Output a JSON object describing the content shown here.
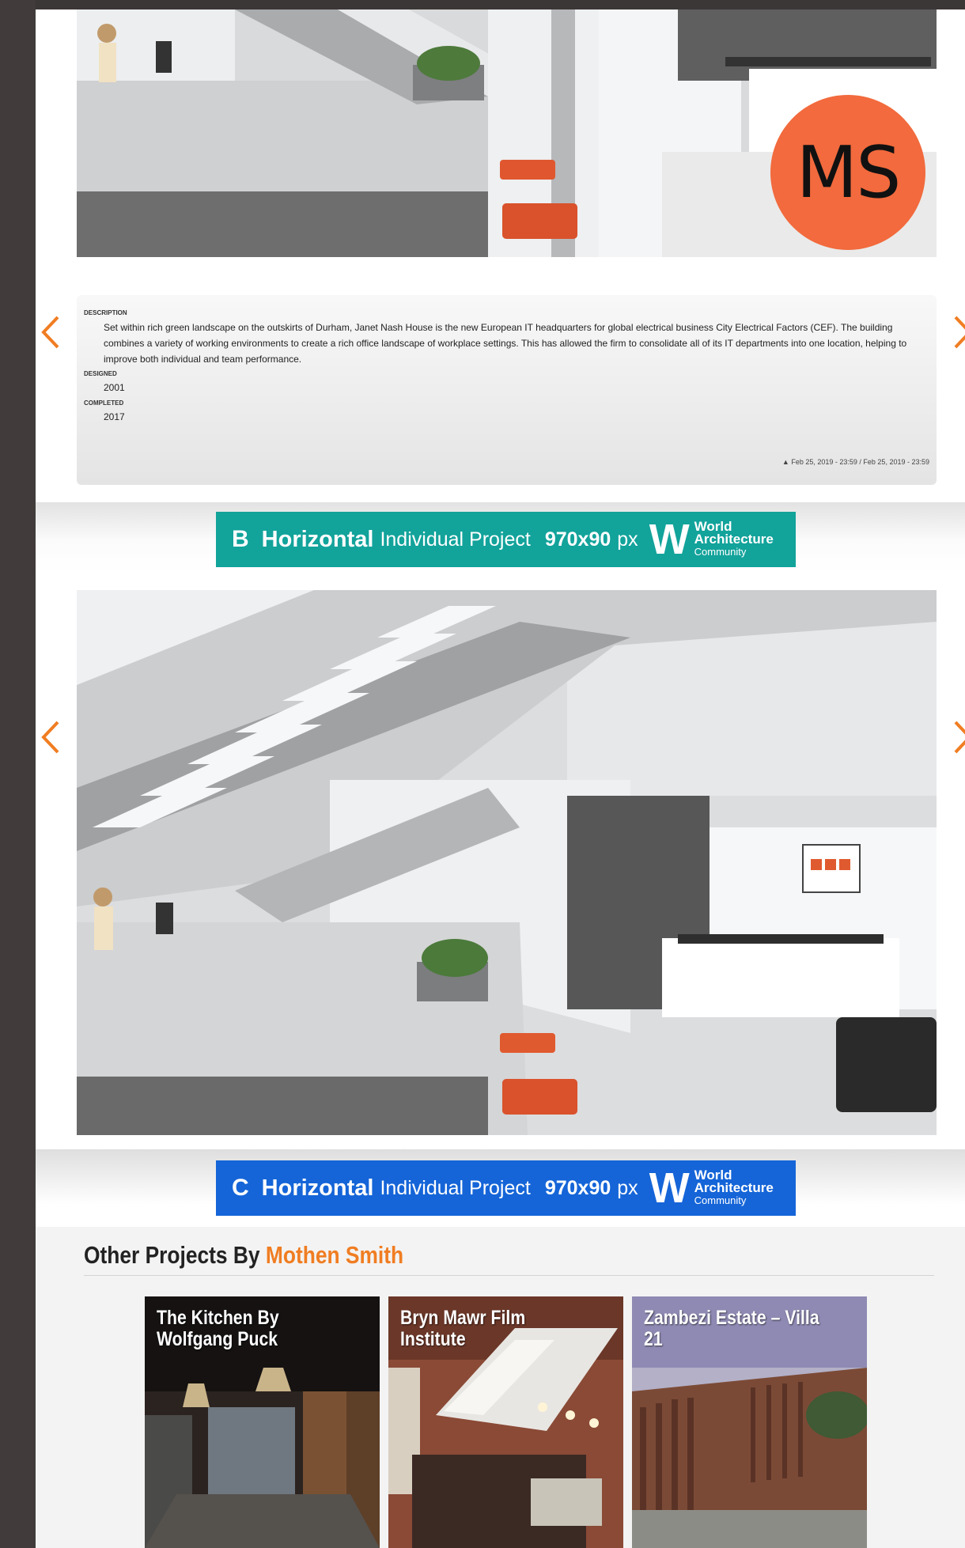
{
  "avatar": {
    "initials": "MS",
    "color": "#f26a3d"
  },
  "nav": {
    "prev_icon": "chevron-left-icon",
    "next_icon": "chevron-right-icon",
    "accent": "#f07d22"
  },
  "description": {
    "label": "DESCRIPTION",
    "text": "Set within rich green landscape on the outskirts of Durham, Janet Nash House is the new European IT headquarters for global electrical business City Electrical Factors (CEF). The building combines a variety of working environments to create a rich office landscape of workplace settings. This has allowed the firm to consolidate all of its IT departments into one location, helping to improve both individual and team performance.",
    "designed_label": "DESIGNED",
    "designed": "2001",
    "completed_label": "COMPLETED",
    "completed": "2017",
    "timestamp": "Feb 25, 2019 - 23:59 / Feb 25, 2019 - 23:59"
  },
  "ads": [
    {
      "letter": "B",
      "horizontal": "Horizontal",
      "project": "Individual Project",
      "size": "970x90",
      "unit": "px",
      "logo_w": "W",
      "logo_l1": "World",
      "logo_l2": "Architecture",
      "logo_l3": "Community",
      "color": "#12a39b"
    },
    {
      "letter": "C",
      "horizontal": "Horizontal",
      "project": "Individual Project",
      "size": "970x90",
      "unit": "px",
      "logo_w": "W",
      "logo_l1": "World",
      "logo_l2": "Architecture",
      "logo_l3": "Community",
      "color": "#1565d8"
    }
  ],
  "other": {
    "title_prefix": "Other Projects By",
    "author": "Mothen Smith",
    "cards": [
      {
        "title": "The Kitchen By Wolfgang Puck"
      },
      {
        "title": "Bryn Mawr Film Institute"
      },
      {
        "title": "Zambezi Estate – Villa 21"
      }
    ]
  }
}
